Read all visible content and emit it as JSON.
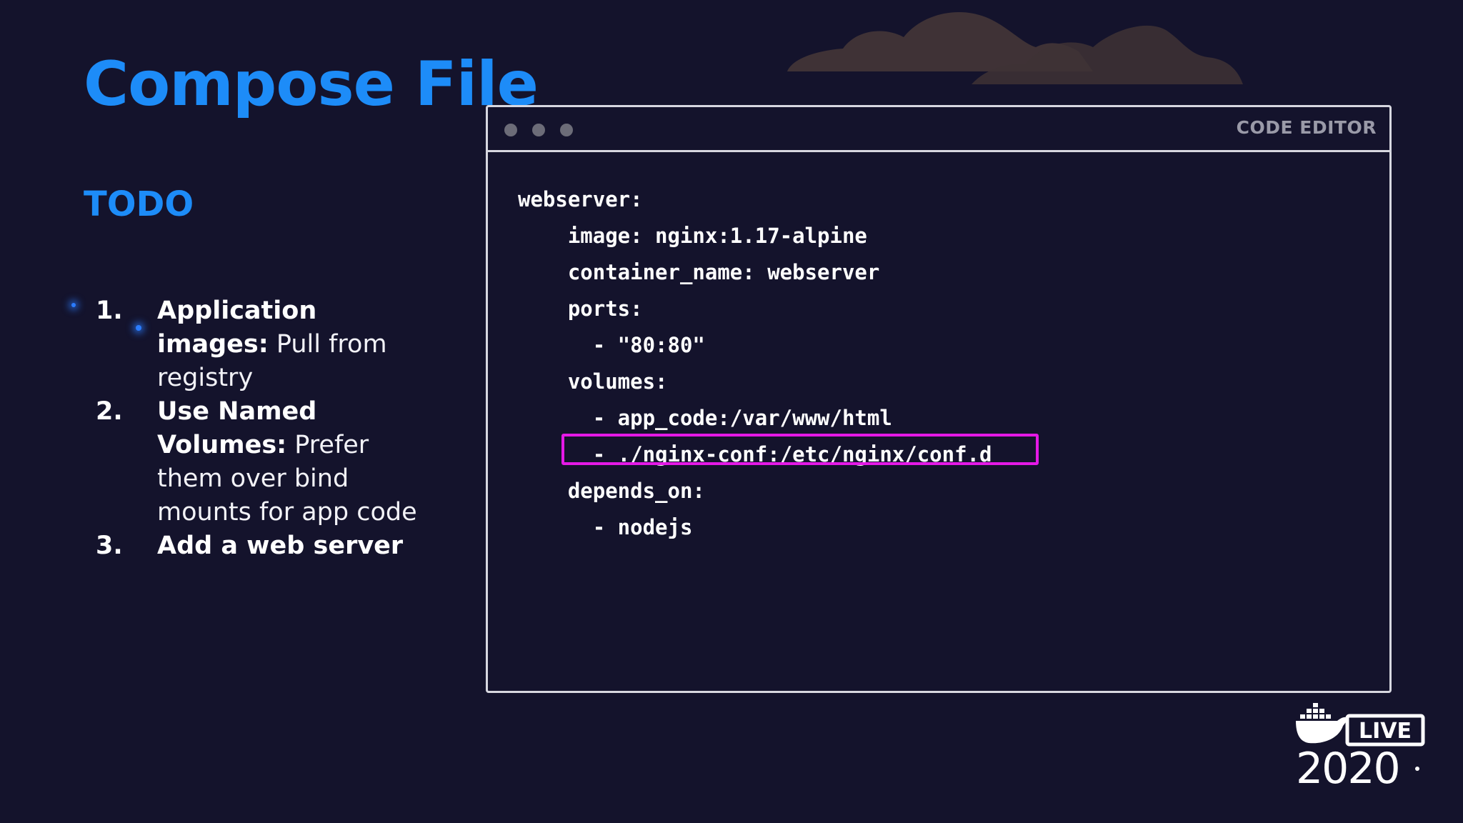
{
  "slide": {
    "title": "Compose File",
    "subtitle": "TODO"
  },
  "todo": [
    {
      "num": "1.",
      "bold": "Application images:",
      "desc": " Pull from registry"
    },
    {
      "num": "2.",
      "bold": "Use Named Volumes:",
      "desc": " Prefer them over bind mounts for app code"
    },
    {
      "num": "3.",
      "bold": "Add a web server",
      "desc": ""
    }
  ],
  "editor": {
    "label": "CODE EDITOR",
    "lines": [
      "webserver:",
      "    image: nginx:1.17-alpine",
      "    container_name: webserver",
      "    ports:",
      "      - \"80:80\"",
      "    volumes:",
      "      - app_code:/var/www/html",
      "      - ./nginx-conf:/etc/nginx/conf.d",
      "    depends_on:",
      "      - nodejs"
    ],
    "highlight_color": "#e419e6"
  },
  "logo": {
    "badge": "LIVE",
    "year": "2020"
  },
  "colors": {
    "background": "#14132c",
    "accent": "#1d8cf8"
  }
}
